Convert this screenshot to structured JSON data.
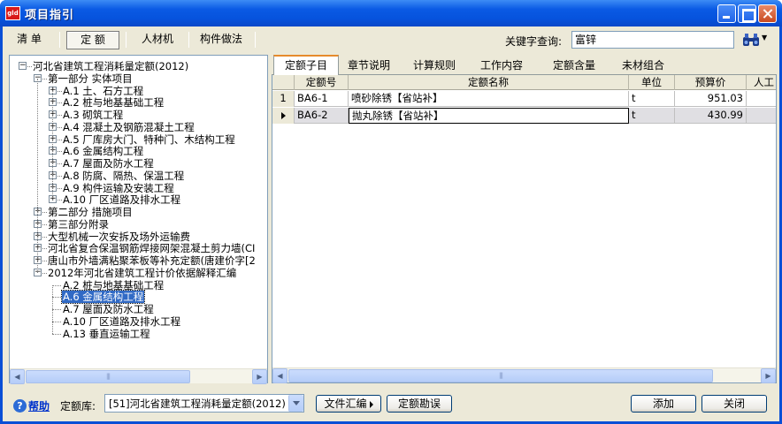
{
  "window": {
    "title": "项目指引",
    "app_icon_text": "gld"
  },
  "toolbar": {
    "tabs": [
      "清 单",
      "定 额",
      "人材机",
      "构件做法"
    ],
    "active_tab": "定 额",
    "keyword_label": "关键字查询:",
    "keyword_value": "富锌"
  },
  "tree": {
    "nodes": [
      {
        "label": "河北省建筑工程消耗量定额(2012)",
        "expander": "-"
      },
      {
        "label": "第一部分 实体项目",
        "expander": "-"
      },
      {
        "label": "A.1 土、石方工程",
        "expander": "+"
      },
      {
        "label": "A.2 桩与地基基础工程",
        "expander": "+"
      },
      {
        "label": "A.3 砌筑工程",
        "expander": "+"
      },
      {
        "label": "A.4 混凝土及钢筋混凝土工程",
        "expander": "+"
      },
      {
        "label": "A.5 厂库房大门、特种门、木结构工程",
        "expander": "+"
      },
      {
        "label": "A.6 金属结构工程",
        "expander": "+"
      },
      {
        "label": "A.7 屋面及防水工程",
        "expander": "+"
      },
      {
        "label": "A.8 防腐、隔热、保温工程",
        "expander": "+"
      },
      {
        "label": "A.9 构件运输及安装工程",
        "expander": "+"
      },
      {
        "label": "A.10 厂区道路及排水工程",
        "expander": "+"
      },
      {
        "label": "第二部分 措施项目",
        "expander": "+"
      },
      {
        "label": "第三部分附录",
        "expander": "+"
      },
      {
        "label": "大型机械一次安拆及场外运输费",
        "expander": "+"
      },
      {
        "label": "河北省复合保温钢筋焊接网架混凝土剪力墙(CI",
        "expander": "+"
      },
      {
        "label": "唐山市外墙满粘聚苯板等补充定额(唐建价字[2",
        "expander": "+"
      },
      {
        "label": "2012年河北省建筑工程计价依据解释汇编",
        "expander": "-"
      },
      {
        "label": "A.2 桩与地基基础工程",
        "expander": ""
      },
      {
        "label": "A.6 金属结构工程",
        "expander": "",
        "selected": true
      },
      {
        "label": "A.7 屋面及防水工程",
        "expander": ""
      },
      {
        "label": "A.10 厂区道路及排水工程",
        "expander": ""
      },
      {
        "label": "A.13 垂直运输工程",
        "expander": ""
      }
    ]
  },
  "right_tabs": [
    "定额子目",
    "章节说明",
    "计算规则",
    "工作内容",
    "定额含量",
    "未材组合"
  ],
  "grid": {
    "columns": [
      "定额号",
      "定额名称",
      "单位",
      "预算价",
      "人工"
    ],
    "rows": [
      {
        "index": "1",
        "code": "BA6-1",
        "name": "喷砂除锈【省站补】",
        "unit": "t",
        "price": "951.03"
      },
      {
        "index": "",
        "code": "BA6-2",
        "name": "抛丸除锈【省站补】",
        "unit": "t",
        "price": "430.99"
      }
    ]
  },
  "bottom": {
    "help": "帮助",
    "lib_label": "定额库:",
    "lib_value": "[51]河北省建筑工程消耗量定额(2012)",
    "btn_file": "文件汇编",
    "btn_errata": "定额勘误",
    "btn_add": "添加",
    "btn_close": "关闭"
  },
  "colors": {
    "title_bar": "#0a5ae4",
    "selection": "#316ac5",
    "active_tab_accent": "#e68b2c"
  }
}
